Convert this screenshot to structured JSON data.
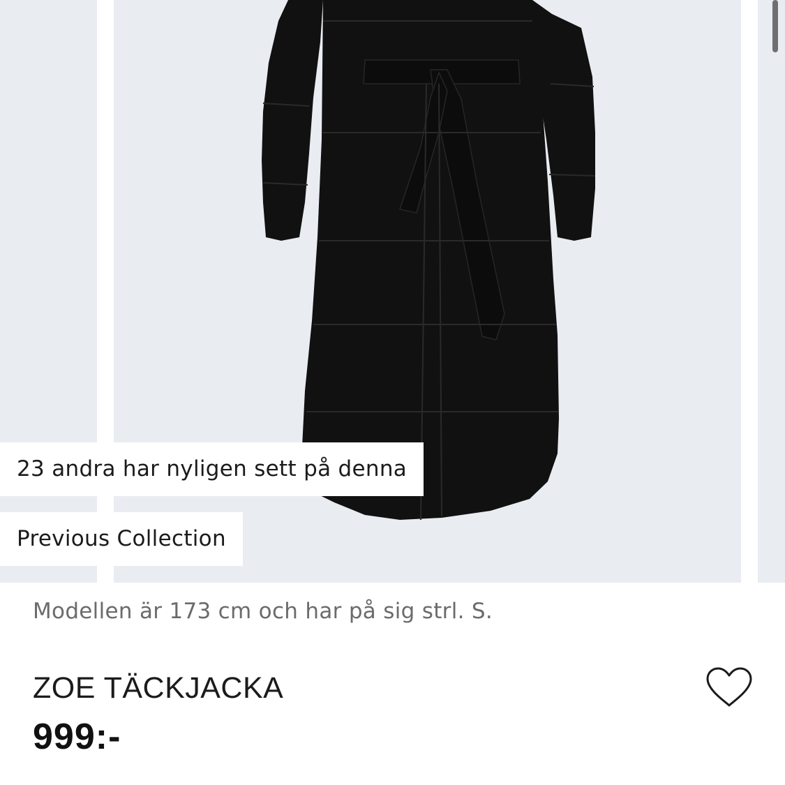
{
  "product": {
    "viewers_badge": "23 andra har nyligen sett på denna",
    "collection_badge": "Previous Collection",
    "model_info": "Modellen är 173 cm och har på sig strl. S.",
    "title": "ZOE TÄCKJACKA",
    "price": "999:-"
  },
  "icons": {
    "wishlist": "heart-outline-icon"
  },
  "colors": {
    "image_background": "#e9ecf1",
    "coat": "#111111",
    "text_primary": "#1b1b1b",
    "text_secondary": "#6b6b6b"
  }
}
